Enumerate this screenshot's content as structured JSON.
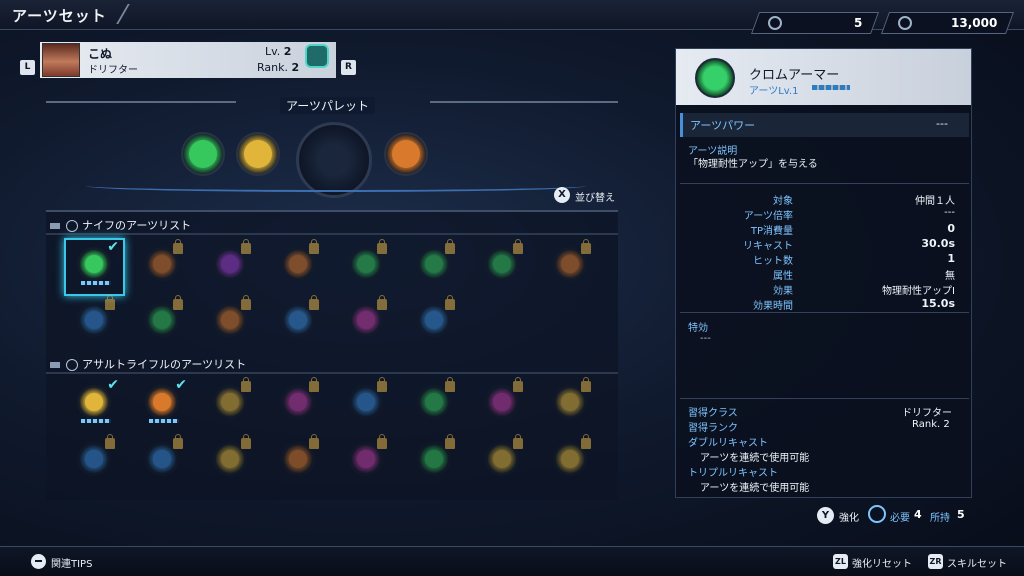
{
  "header": {
    "title": "アーツセット"
  },
  "currency": {
    "fragments": "5",
    "credits": "13,000"
  },
  "character": {
    "name": "こぬ",
    "class": "ドリフター",
    "level_label": "Lv.",
    "level": "2",
    "rank_label": "Rank.",
    "rank": "2",
    "prev_key": "L",
    "next_key": "R"
  },
  "palette": {
    "title": "アーツパレット",
    "slots": [
      {
        "icon": "crom-armor-icon",
        "color": "#36c85c"
      },
      {
        "icon": "rifle-art-icon",
        "color": "#e0b53a"
      },
      {
        "icon": "empty-slot",
        "color": ""
      },
      {
        "icon": "rifle-art-icon",
        "color": "#d9792c"
      }
    ],
    "sort_key": "X",
    "sort_label": "並び替え"
  },
  "lists": {
    "knife_title": "ナイフのアーツリスト",
    "rifle_title": "アサルトライフルのアーツリスト",
    "knife_arts": [
      {
        "color": "#36c85c",
        "locked": false,
        "equipped": true,
        "selected": true
      },
      {
        "color": "#d9792c",
        "locked": true
      },
      {
        "color": "#9b3fc9",
        "locked": true
      },
      {
        "color": "#d9792c",
        "locked": true
      },
      {
        "color": "#36c85c",
        "locked": true
      },
      {
        "color": "#36c85c",
        "locked": true
      },
      {
        "color": "#36c85c",
        "locked": true
      },
      {
        "color": "#d9792c",
        "locked": true
      },
      {
        "color": "#3a8bd9",
        "locked": true
      },
      {
        "color": "#36c85c",
        "locked": true
      },
      {
        "color": "#d9792c",
        "locked": true
      },
      {
        "color": "#3a8bd9",
        "locked": true
      },
      {
        "color": "#c23fa6",
        "locked": true
      },
      {
        "color": "#3a8bd9",
        "locked": true
      }
    ],
    "rifle_arts": [
      {
        "color": "#e0b53a",
        "locked": false,
        "equipped": true
      },
      {
        "color": "#d9792c",
        "locked": false,
        "equipped": true
      },
      {
        "color": "#e0b53a",
        "locked": true
      },
      {
        "color": "#c23fa6",
        "locked": true
      },
      {
        "color": "#3a8bd9",
        "locked": true
      },
      {
        "color": "#36c85c",
        "locked": true
      },
      {
        "color": "#c23fa6",
        "locked": true
      },
      {
        "color": "#e0b53a",
        "locked": true
      },
      {
        "color": "#3a8bd9",
        "locked": true
      },
      {
        "color": "#3a8bd9",
        "locked": true
      },
      {
        "color": "#e0b53a",
        "locked": true
      },
      {
        "color": "#d9792c",
        "locked": true
      },
      {
        "color": "#c23fa6",
        "locked": true
      },
      {
        "color": "#36c85c",
        "locked": true
      },
      {
        "color": "#e0b53a",
        "locked": true
      },
      {
        "color": "#e0b53a",
        "locked": true
      }
    ]
  },
  "detail": {
    "name": "クロムアーマー",
    "level_text": "アーツLv.1",
    "power_label": "アーツパワー",
    "power_value": "---",
    "desc_label": "アーツ説明",
    "desc_text": "「物理耐性アップ」を与える",
    "stats": [
      {
        "label": "対象",
        "value": "仲間１人",
        "bold": false
      },
      {
        "label": "アーツ倍率",
        "value": "---",
        "bold": false
      },
      {
        "label": "TP消費量",
        "value": "0",
        "bold": true
      },
      {
        "label": "リキャスト",
        "value": "30.0s",
        "bold": true
      },
      {
        "label": "ヒット数",
        "value": "1",
        "bold": true
      },
      {
        "label": "属性",
        "value": "無",
        "bold": false
      },
      {
        "label": "効果",
        "value": "物理耐性アップI",
        "bold": false
      },
      {
        "label": "効果時間",
        "value": "15.0s",
        "bold": true
      }
    ],
    "special_label": "特効",
    "special_value": "---",
    "class_label": "習得クラス",
    "class_value": "ドリフター",
    "rank_label": "習得ランク",
    "rank_value": "Rank. 2",
    "double_label": "ダブルリキャスト",
    "double_text": "アーツを連続で使用可能",
    "triple_label": "トリプルリキャスト",
    "triple_text": "アーツを連続で使用可能"
  },
  "enhance": {
    "key": "Y",
    "label": "強化",
    "need_label": "必要",
    "need_value": "4",
    "have_label": "所持",
    "have_value": "5"
  },
  "footer": {
    "tips_label": "関連TIPS",
    "zl_key": "ZL",
    "zl_label": "強化リセット",
    "zr_key": "ZR",
    "zr_label": "スキルセット"
  }
}
